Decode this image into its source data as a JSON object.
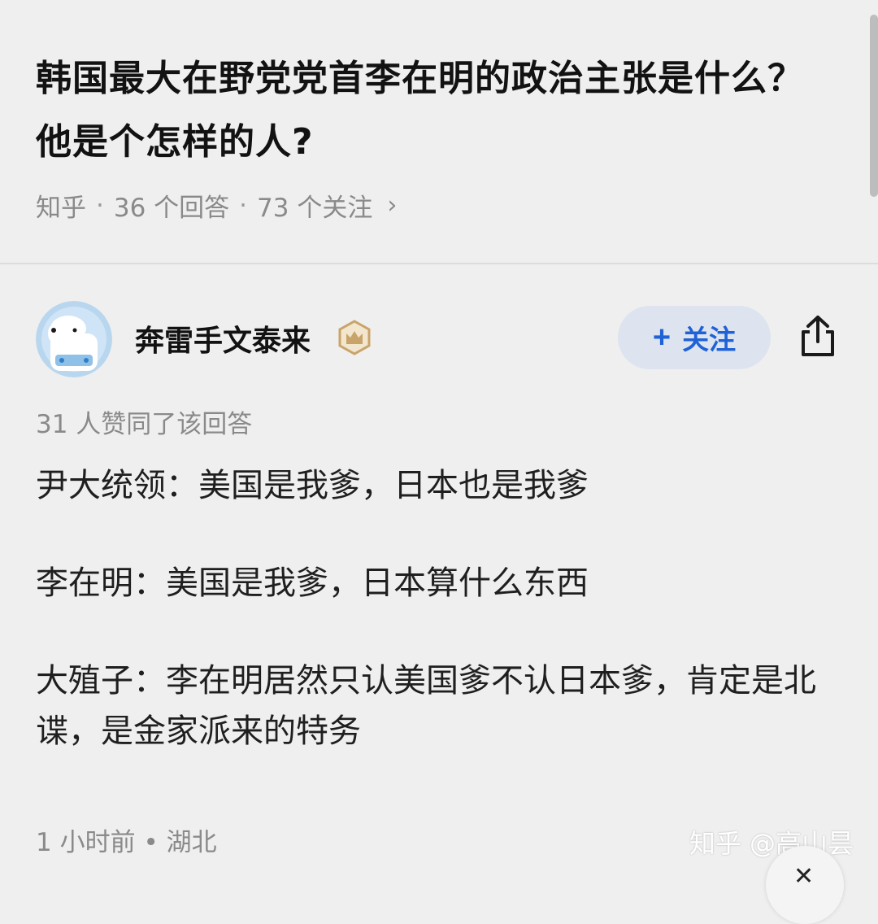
{
  "question": {
    "title": "韩国最大在野党党首李在明的政治主张是什么？他是个怎样的人?",
    "source": "知乎",
    "answers": "36 个回答",
    "followers": "73 个关注"
  },
  "answer": {
    "author": "奔雷手文泰来",
    "follow_label": "关注",
    "votes": "31 人赞同了该回答",
    "paragraphs": [
      "尹大统领：美国是我爹，日本也是我爹",
      "李在明：美国是我爹，日本算什么东西",
      "大殖子：李在明居然只认美国爹不认日本爹，肯定是北谍，是金家派来的特务"
    ],
    "time": "1 小时前",
    "location": "湖北"
  },
  "watermark": "知乎 @高山昙",
  "icons": {
    "follow": "plus-icon",
    "share": "share-icon",
    "more": "chevron-right-icon",
    "badge": "crown-badge-icon",
    "close": "close-icon"
  },
  "colors": {
    "background": "#efefef",
    "accent": "#1f62d6",
    "follow_bg": "#dde4ef",
    "meta_text": "#8a8a8a",
    "badge_gold": "#c9a46a"
  }
}
